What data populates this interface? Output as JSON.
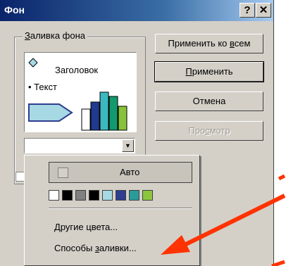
{
  "window": {
    "title": "Фон",
    "help_label": "?",
    "close_label": "✕"
  },
  "group": {
    "label_prefix": "",
    "label_underlined": "З",
    "label_rest": "аливка фона"
  },
  "preview": {
    "heading": "Заголовок",
    "bullet": "• Текст",
    "bar_colors": [
      "#ffffff",
      "#1f3a8f",
      "#3cb8c0",
      "#12996e",
      "#86c23a"
    ]
  },
  "buttons": [
    {
      "pre": "Применить ко ",
      "u": "в",
      "post": "сем",
      "default": false,
      "disabled": false
    },
    {
      "pre": "",
      "u": "П",
      "post": "рименить",
      "default": true,
      "disabled": false
    },
    {
      "pre": "",
      "u": "",
      "post": "Отмена",
      "default": false,
      "disabled": false
    },
    {
      "pre": "Про",
      "u": "с",
      "post": "мотр",
      "default": false,
      "disabled": true
    }
  ],
  "popup": {
    "auto_label": "Авто",
    "swatches": [
      "#ffffff",
      "#000000",
      "#808080",
      "#000000",
      "#a6d9e3",
      "#2e3d8f",
      "#2a9a9a",
      "#8cc63f"
    ],
    "more_colors": {
      "u": "Д",
      "rest": "ругие цвета..."
    },
    "fill_effects": {
      "pre": "Способы ",
      "u": "з",
      "rest": "аливки..."
    }
  },
  "colors": {
    "accent_arrow": "#ff3300",
    "title_bar": "#0a246a"
  }
}
